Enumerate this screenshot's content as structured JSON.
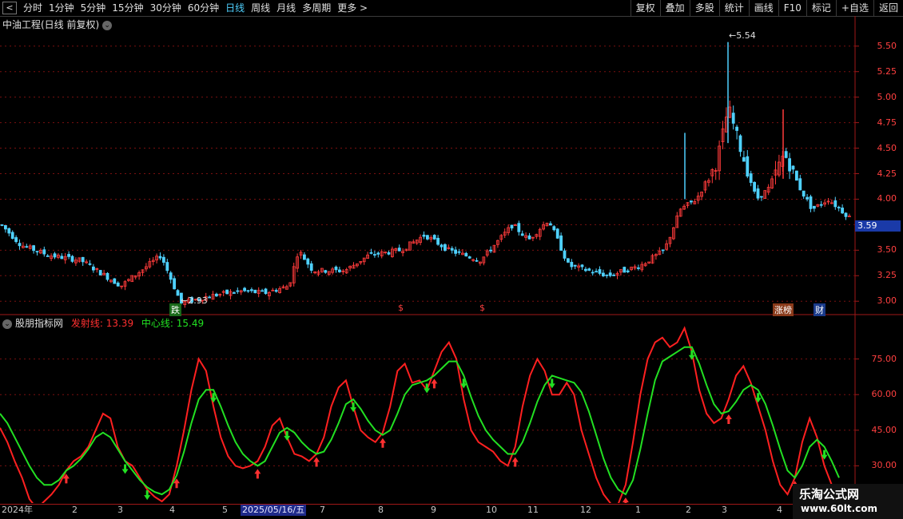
{
  "toolbar": {
    "back_glyph": "<",
    "periods": [
      "分时",
      "1分钟",
      "5分钟",
      "15分钟",
      "30分钟",
      "60分钟",
      "日线",
      "周线",
      "月线",
      "多周期",
      "更多 >"
    ],
    "active_period": "日线",
    "right_buttons": [
      "复权",
      "叠加",
      "多股",
      "统计",
      "画线",
      "F10",
      "标记",
      "+自选",
      "返回"
    ]
  },
  "main_panel": {
    "title": "中油工程(日线 前复权)",
    "price_axis": [
      "5.50",
      "5.25",
      "5.00",
      "4.75",
      "4.50",
      "4.25",
      "4.00",
      "3.75",
      "3.50",
      "3.25",
      "3.00"
    ],
    "current_price": "3.59",
    "high_marker": "5.54",
    "low_marker": "2.93",
    "event_labels": [
      "跌",
      "$",
      "$",
      "涨榜",
      "财"
    ]
  },
  "indicator_panel": {
    "name": "股朋指标网",
    "line1_label": "发射线:",
    "line1_value": "13.39",
    "line2_label": "中心线:",
    "line2_value": "15.49",
    "axis": [
      "75.00",
      "60.00",
      "45.00",
      "30.00"
    ]
  },
  "date_axis": {
    "labels": [
      "2024年",
      "2",
      "3",
      "4",
      "5",
      "2025/05/16/五",
      "7",
      "8",
      "9",
      "10",
      "11",
      "12",
      "1",
      "2",
      "3",
      "4"
    ]
  },
  "watermark": {
    "line1": "乐淘公式网",
    "line2": "www.60lt.com"
  },
  "colors": {
    "up": "#ff3b3b",
    "down": "#4fd1ff",
    "signal": "#ff2020",
    "center": "#22e022",
    "grid": "#7a1010"
  },
  "chart_data": {
    "type": "line",
    "price_range": [
      2.9,
      5.6
    ],
    "indicator_range": [
      15,
      90
    ],
    "series": [
      {
        "name": "发射线",
        "values": [
          46,
          40,
          32,
          25,
          16,
          12,
          15,
          18,
          22,
          28,
          32,
          34,
          38,
          45,
          52,
          50,
          38,
          32,
          30,
          25,
          20,
          17,
          15,
          18,
          30,
          45,
          62,
          75,
          70,
          55,
          42,
          34,
          30,
          29,
          30,
          32,
          38,
          47,
          50,
          42,
          35,
          34,
          32,
          35,
          42,
          55,
          63,
          66,
          55,
          45,
          42,
          40,
          44,
          55,
          70,
          73,
          65,
          66,
          62,
          70,
          78,
          82,
          75,
          58,
          45,
          40,
          38,
          36,
          32,
          30,
          38,
          55,
          68,
          75,
          70,
          60,
          60,
          65,
          60,
          45,
          35,
          25,
          18,
          14,
          14,
          22,
          40,
          60,
          75,
          82,
          84,
          80,
          82,
          88,
          78,
          62,
          52,
          48,
          50,
          58,
          68,
          72,
          65,
          55,
          45,
          32,
          22,
          18,
          25,
          40,
          50,
          42,
          30,
          22,
          14
        ]
      },
      {
        "name": "中心线",
        "values": [
          52,
          48,
          42,
          36,
          30,
          25,
          22,
          22,
          24,
          28,
          30,
          33,
          37,
          42,
          44,
          42,
          37,
          32,
          28,
          24,
          21,
          19,
          18,
          20,
          26,
          36,
          48,
          58,
          62,
          62,
          55,
          47,
          40,
          35,
          32,
          30,
          32,
          38,
          44,
          46,
          44,
          40,
          37,
          35,
          36,
          41,
          48,
          56,
          58,
          54,
          49,
          45,
          43,
          45,
          52,
          60,
          64,
          65,
          66,
          68,
          71,
          74,
          74,
          68,
          59,
          51,
          45,
          41,
          38,
          35,
          35,
          40,
          48,
          57,
          64,
          68,
          67,
          66,
          65,
          61,
          53,
          43,
          33,
          25,
          20,
          18,
          24,
          37,
          52,
          66,
          74,
          76,
          78,
          80,
          80,
          73,
          64,
          56,
          52,
          53,
          57,
          62,
          64,
          62,
          56,
          47,
          37,
          28,
          25,
          30,
          38,
          41,
          38,
          32,
          25
        ]
      }
    ]
  }
}
